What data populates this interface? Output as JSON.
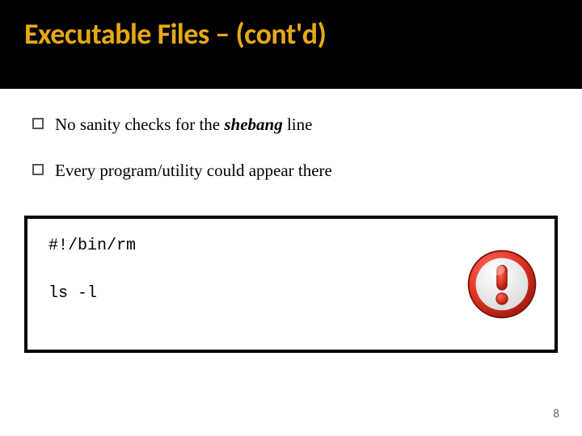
{
  "header": {
    "title": "Executable Files – (cont'd)"
  },
  "bullets": [
    {
      "pre": "No sanity checks for the ",
      "em": "shebang",
      "post": " line"
    },
    {
      "pre": "Every program/utility could appear there",
      "em": "",
      "post": ""
    }
  ],
  "code": {
    "line1": "#!/bin/rm",
    "line2": "ls -l"
  },
  "page_number": "8"
}
